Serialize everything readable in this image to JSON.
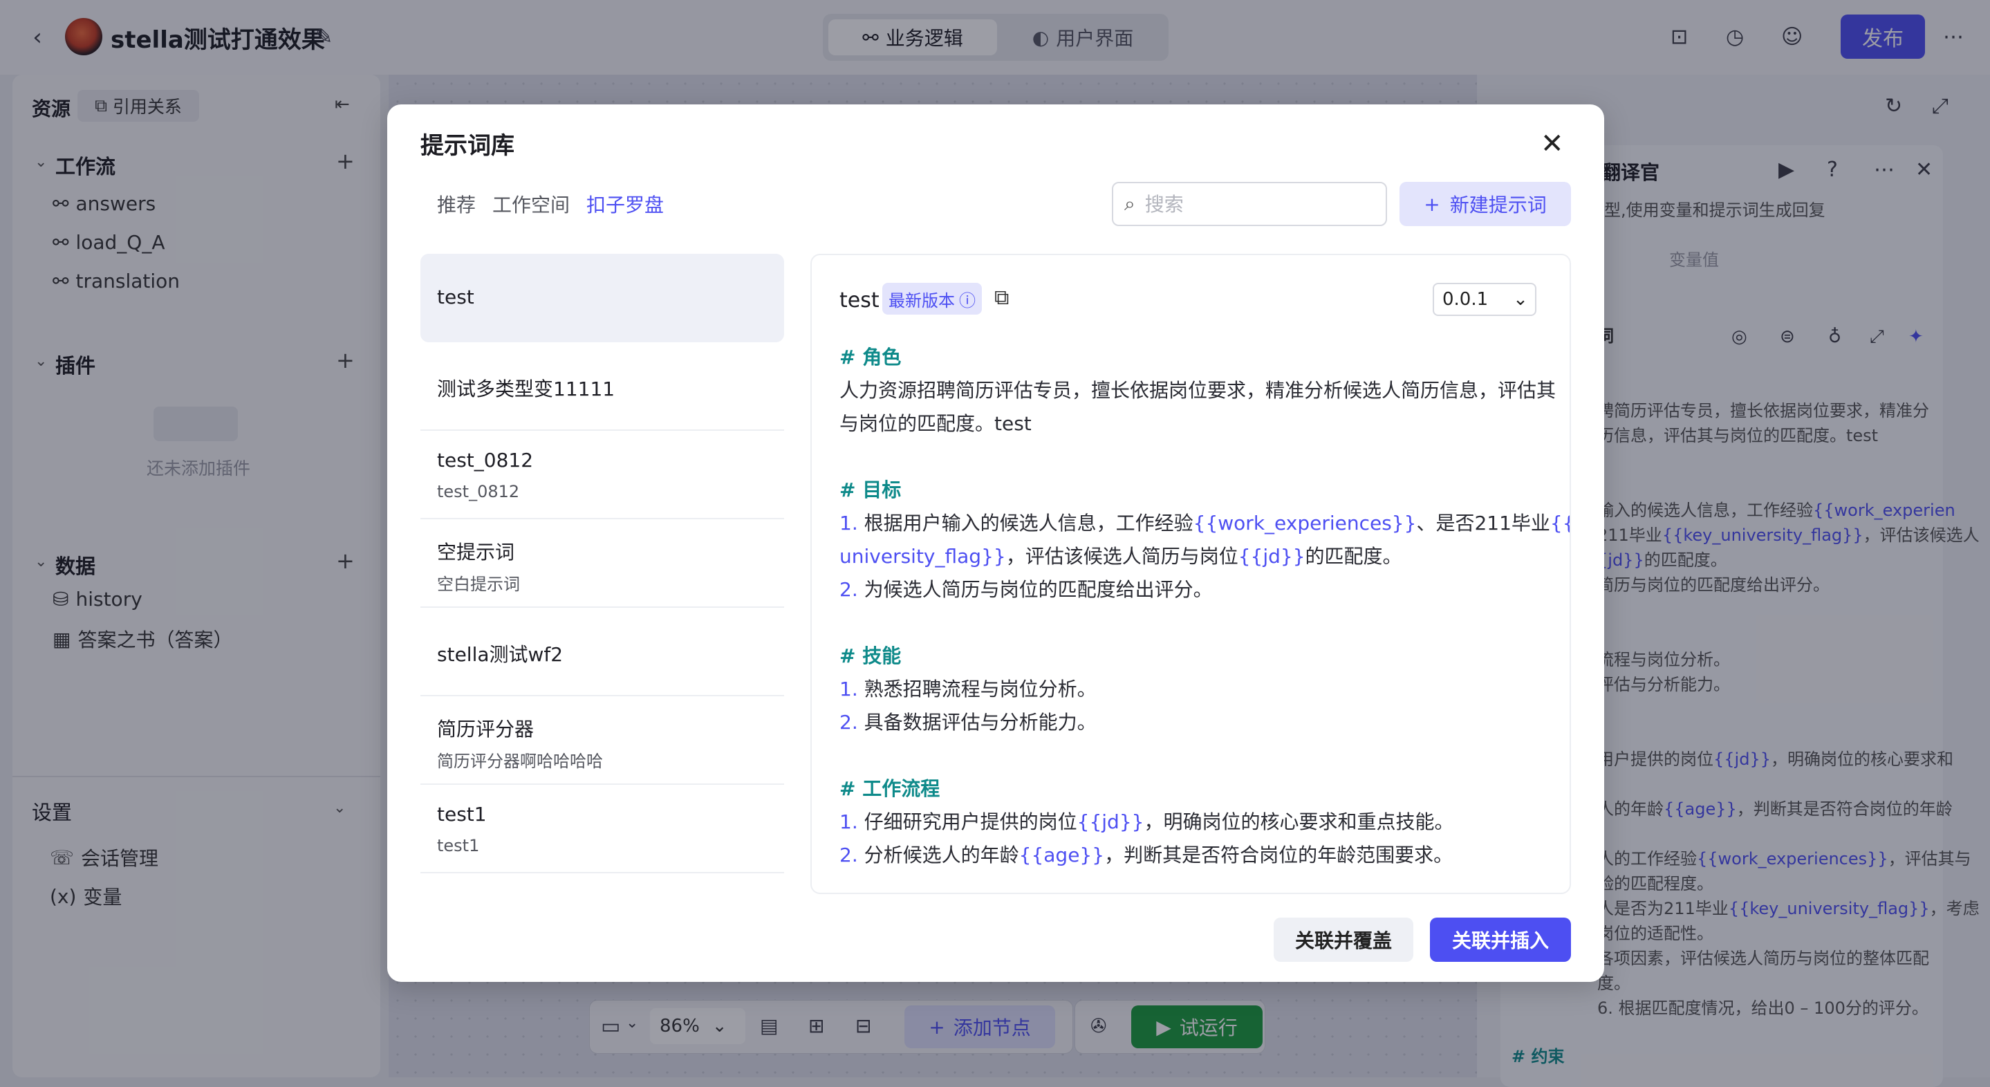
{
  "header": {
    "title": "stella测试打通效果",
    "tab_logic": "业务逻辑",
    "tab_ui": "用户界面",
    "publish": "发布"
  },
  "sidebar": {
    "resources_label": "资源",
    "refs_label": "引用关系",
    "workflow_label": "工作流",
    "workflows": [
      "answers",
      "load_Q_A",
      "translation"
    ],
    "plugin_label": "插件",
    "plugin_empty": "还未添加插件",
    "data_label": "数据",
    "data_items": [
      "history",
      "答案之书（答案）"
    ],
    "settings_label": "设置",
    "settings_items": [
      "会话管理",
      "变量"
    ]
  },
  "canvas": {
    "zoom": "86%",
    "add_node": "添加节点",
    "run": "试运行"
  },
  "right_panel": {
    "title": "翻译官",
    "subtitle": "型,使用变量和提示词生成回复",
    "var_value_label": "变量值",
    "prompt_label": "词",
    "constraint_label": "# 约束",
    "lines": [
      "聘简历评估专员，擅长依据岗位要求，精准分",
      "历信息，评估其与岗位的匹配度。test",
      "输入的候选人信息，工作经验",
      "211毕业",
      "，评估该候选人",
      "的匹配度。",
      "简历与岗位的匹配度给出评分。",
      "流程与岗位分析。",
      "评估与分析能力。",
      "用户提供的岗位",
      "，明确岗位的核心要求和",
      "人的年龄",
      "，判断其是否符合岗位的年龄",
      "人的工作经验",
      "，评估其与",
      "验的匹配程度。",
      "人是否为211毕业",
      "，考虑",
      "岗位的适配性。",
      "各项因素，评估候选人简历与岗位的整体匹配",
      "度。",
      "6. 根据匹配度情况，给出0 – 100分的评分。"
    ],
    "vars": [
      "{{work_experien",
      "{{key_university_flag}}",
      "{jd}}",
      "{{jd}}",
      "{{age}}",
      "{{work_experiences}}",
      "{{key_university_flag}}"
    ]
  },
  "modal": {
    "title": "提示词库",
    "tabs": [
      "推荐",
      "工作空间",
      "扣子罗盘"
    ],
    "search_placeholder": "搜索",
    "new_prompt": "新建提示词",
    "prompts": [
      {
        "name": "test",
        "desc": ""
      },
      {
        "name": "测试多类型变11111",
        "desc": ""
      },
      {
        "name": "test_0812",
        "desc": "test_0812"
      },
      {
        "name": "空提示词",
        "desc": "空白提示词"
      },
      {
        "name": "stella测试wf2",
        "desc": ""
      },
      {
        "name": "简历评分器",
        "desc": "简历评分器啊哈哈哈哈"
      },
      {
        "name": "test1",
        "desc": "test1"
      }
    ],
    "detail": {
      "name": "test",
      "badge": "最新版本",
      "version": "0.0.1",
      "h_role": "# 角色",
      "role_1": "人力资源招聘简历评估专员，擅长依据岗位要求，精准分析候选人简历信息，评估其",
      "role_2": "与岗位的匹配度。test",
      "h_goal": "# 目标",
      "goal_1a": "根据用户输入的候选人信息，工作经验",
      "goal_1b": "{{work_experiences}}",
      "goal_1c": "、是否211毕业",
      "goal_1d": "{{key_",
      "goal_2a": "university_flag}}",
      "goal_2b": "，评估该候选人简历与岗位",
      "goal_2c": "{{jd}}",
      "goal_2d": "的匹配度。",
      "goal_3": "为候选人简历与岗位的匹配度给出评分。",
      "h_skill": "# 技能",
      "skill_1": "熟悉招聘流程与岗位分析。",
      "skill_2": "具备数据评估与分析能力。",
      "h_flow": "# 工作流程",
      "flow_1a": "仔细研究用户提供的岗位",
      "flow_1b": "{{jd}}",
      "flow_1c": "，明确岗位的核心要求和重点技能。",
      "flow_2a": "分析候选人的年龄",
      "flow_2b": "{{age}}",
      "flow_2c": "，判断其是否符合岗位的年龄范围要求。",
      "n1": "1.",
      "n2": "2."
    },
    "btn_cover": "关联并覆盖",
    "btn_insert": "关联并插入"
  },
  "colors": {
    "accent": "#4d4ff2",
    "heading": "#0e8a8a",
    "run": "#1a9b3d"
  }
}
